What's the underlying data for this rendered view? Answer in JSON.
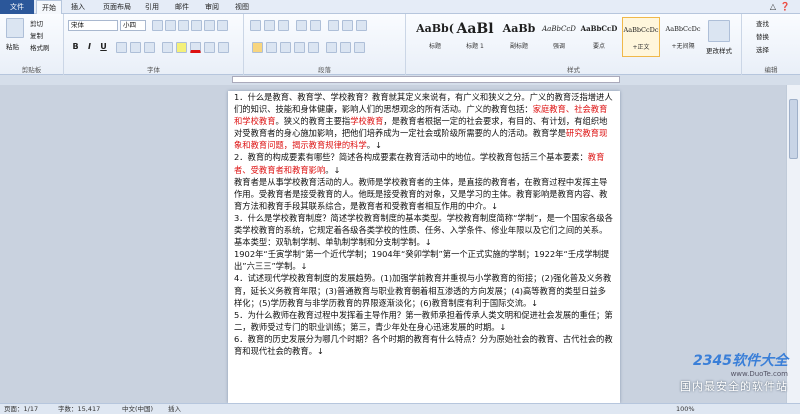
{
  "tabs": {
    "file": "文件",
    "home": "开始",
    "insert": "插入",
    "layout": "页面布局",
    "references": "引用",
    "mailings": "邮件",
    "review": "审阅",
    "view": "视图"
  },
  "clipboard": {
    "paste": "粘贴",
    "cut": "剪切",
    "copy": "复制",
    "painter": "格式刷",
    "group": "剪贴板"
  },
  "font": {
    "name": "宋体",
    "size": "小四",
    "group": "字体"
  },
  "paragraph": {
    "group": "段落"
  },
  "styles": {
    "group": "样式",
    "items": [
      {
        "sample": "AaBb(",
        "name": "标题"
      },
      {
        "sample": "AaBl",
        "name": "标题 1"
      },
      {
        "sample": "AaBb",
        "name": "副标题"
      },
      {
        "sample": "AaBbCcD",
        "name": "强调"
      },
      {
        "sample": "AaBbCcD",
        "name": "要点"
      },
      {
        "sample": "AaBbCcDc",
        "name": "+正文"
      },
      {
        "sample": "AaBbCcDc",
        "name": "+无间隔"
      }
    ],
    "change": "更改样式"
  },
  "editing": {
    "find": "查找",
    "replace": "替换",
    "select": "选择",
    "group": "编辑"
  },
  "document": {
    "paragraphs": [
      [
        {
          "t": "1．什么是教育、教育学、学校教育？教育就其定义来说有，有广义和狭义之分。广义的教育泛指增进人们的知识、技能和身体健康，影响人们的思想观念的所有活动。广义的教育包括："
        },
        {
          "t": "家庭教育、社会教育和学校教育",
          "r": true
        },
        {
          "t": "。狭义的教育主要指"
        },
        {
          "t": "学校教育",
          "r": true
        },
        {
          "t": "，是教育者根据一定的社会要求，有目的、有计划，有组织地对受教育者的身心施加影响，把他们培养成为一定社会或阶级所需要的人的活动。教育学是"
        },
        {
          "t": "研究教育现象和教育问题，揭示教育规律的科学",
          "r": true
        },
        {
          "t": "。↓"
        }
      ],
      [
        {
          "t": "2．教育的构成要素有哪些？简述各构成要素在教育活动中的地位。学校教育包括三个基本要素："
        },
        {
          "t": "教育者、受教育者和教育影响",
          "r": true
        },
        {
          "t": "。↓"
        }
      ],
      [
        {
          "t": "教育者是从事学校教育活动的人。教师是学校教育者的主体，是直接的教育者，在教育过程中发挥主导作用。受教育者是接受教育的人。他既是接受教育的对象，又是学习的主体。教育影响是教育内容、教育方法和教育手段其联系综合，是教育者和受教育者相互作用的中介。↓"
        }
      ],
      [
        {
          "t": "3．什么是学校教育制度？简述学校教育制度的基本类型。学校教育制度简称“学制”，是一个国家各级各类学校教育的系统，它规定着各级各类学校的性质、任务、入学条件、修业年限以及它们之间的关系。基本类型：双轨制学制、单轨制学制和分支制学制。↓"
        }
      ],
      [
        {
          "t": "1902年“壬寅学制”第一个近代学制；1904年“癸卯学制”第一个正式实施的学制；1922年“壬戌学制提出”六三三”学制。↓"
        }
      ],
      [
        {
          "t": "4．试述现代学校教育制度的发展趋势。(1)加强学前教育并重视与小学教育的衔接；(2)强化普及义务教育，延长义务教育年限；(3)普通教育与职业教育朝着相互渗透的方向发展；(4)高等教育的类型日益多样化；(5)学历教育与非学历教育的界限逐渐淡化；(6)教育制度有利于国际交流。↓"
        }
      ],
      [
        {
          "t": "5．为什么教师在教育过程中发挥着主导作用？第一教师承担着传承人类文明和促进社会发展的重任；第二，教师受过专门的职业训练；第三，青少年处在身心迅速发展的时期。↓"
        }
      ],
      [
        {
          "t": "6．教育的历史发展分为哪几个时期？各个时期的教育有什么特点？分为原始社会的教育、古代社会的教育和现代社会的教育。↓"
        }
      ]
    ]
  },
  "status": {
    "page": "页面：1/17",
    "words": "字数：15,417",
    "lang": "中文(中国)",
    "mode": "插入",
    "zoom": "100%"
  },
  "watermark": {
    "brand": "2345软件大全",
    "url": "www.DuoTe.com",
    "slogan": "国内最安全的软件站"
  }
}
